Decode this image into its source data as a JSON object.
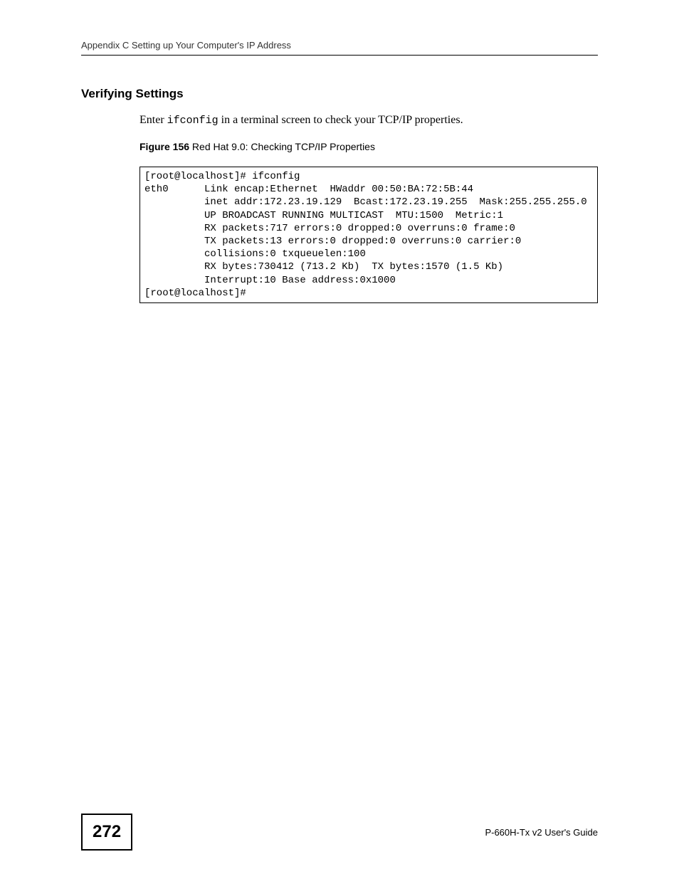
{
  "header": {
    "text": "Appendix C Setting up Your Computer's IP Address"
  },
  "section": {
    "heading": "Verifying Settings",
    "body_prefix": "Enter ",
    "body_command": "ifconfig",
    "body_suffix": " in a terminal screen to check your TCP/IP properties."
  },
  "figure": {
    "label": "Figure 156",
    "caption": "   Red Hat 9.0: Checking TCP/IP Properties"
  },
  "terminal": {
    "content": "[root@localhost]# ifconfig \neth0      Link encap:Ethernet  HWaddr 00:50:BA:72:5B:44  \n          inet addr:172.23.19.129  Bcast:172.23.19.255  Mask:255.255.255.0\n          UP BROADCAST RUNNING MULTICAST  MTU:1500  Metric:1\n          RX packets:717 errors:0 dropped:0 overruns:0 frame:0\n          TX packets:13 errors:0 dropped:0 overruns:0 carrier:0\n          collisions:0 txqueuelen:100 \n          RX bytes:730412 (713.2 Kb)  TX bytes:1570 (1.5 Kb)\n          Interrupt:10 Base address:0x1000 \n[root@localhost]#"
  },
  "footer": {
    "page_number": "272",
    "guide_text": "P-660H-Tx v2 User's Guide"
  }
}
